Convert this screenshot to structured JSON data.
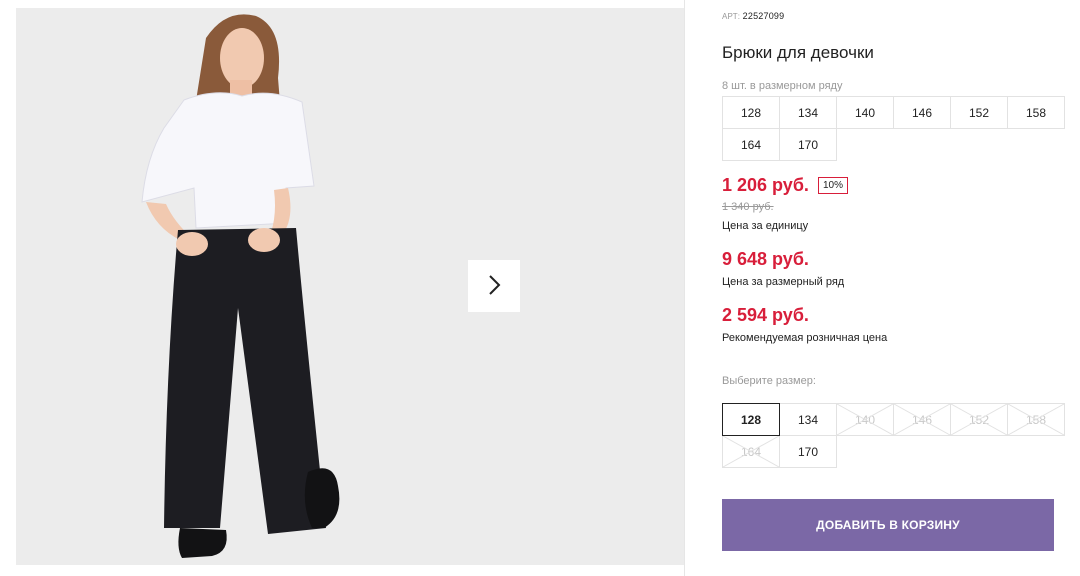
{
  "product": {
    "article_prefix": "АРТ:",
    "article_number": "22527099",
    "title": "Брюки для девочки",
    "pack_label": "8 шт. в размерном ряду",
    "pack_sizes": [
      "128",
      "134",
      "140",
      "146",
      "152",
      "158",
      "164",
      "170"
    ]
  },
  "pricing": {
    "unit_price": "1 206 руб.",
    "discount_badge": "10%",
    "old_price": "1 340 руб.",
    "unit_label": "Цена за единицу",
    "pack_price": "9 648 руб.",
    "pack_label": "Цена за размерный ряд",
    "retail_price": "2 594 руб.",
    "retail_label": "Рекомендуемая розничная цена"
  },
  "size_select": {
    "label": "Выберите размер:",
    "options": [
      {
        "size": "128",
        "state": "selected"
      },
      {
        "size": "134",
        "state": "available"
      },
      {
        "size": "140",
        "state": "disabled"
      },
      {
        "size": "146",
        "state": "disabled"
      },
      {
        "size": "152",
        "state": "disabled"
      },
      {
        "size": "158",
        "state": "disabled"
      },
      {
        "size": "164",
        "state": "disabled"
      },
      {
        "size": "170",
        "state": "available"
      }
    ]
  },
  "actions": {
    "add_to_cart": "ДОБАВИТЬ В КОРЗИНУ"
  },
  "gallery": {
    "next_icon": "chevron-right-icon"
  },
  "colors": {
    "price": "#d81e3a",
    "button": "#7b68a6"
  }
}
